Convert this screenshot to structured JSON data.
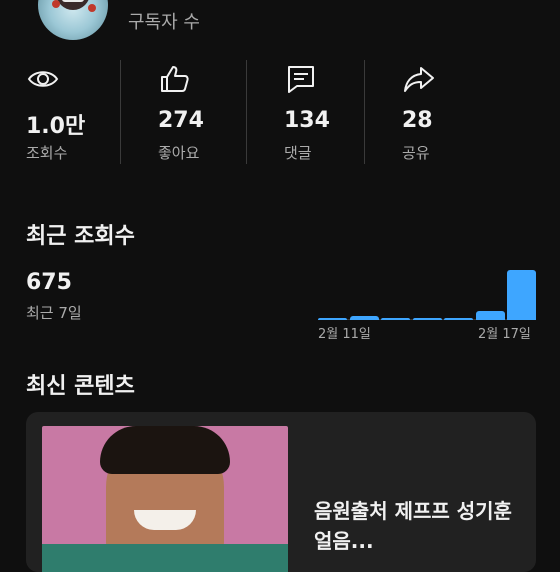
{
  "channel": {
    "subscribers_label": "구독자 수"
  },
  "stats": [
    {
      "icon": "eye-icon",
      "value": "1.0만",
      "label": "조회수"
    },
    {
      "icon": "thumbs-up-icon",
      "value": "274",
      "label": "좋아요"
    },
    {
      "icon": "comment-icon",
      "value": "134",
      "label": "댓글"
    },
    {
      "icon": "share-icon",
      "value": "28",
      "label": "공유"
    }
  ],
  "recent_views": {
    "title": "최근 조회수",
    "count": "675",
    "period": "최근 7일"
  },
  "chart_data": {
    "type": "bar",
    "categories": [
      "2월 11일",
      "2월 12일",
      "2월 13일",
      "2월 14일",
      "2월 15일",
      "2월 16일",
      "2월 17일"
    ],
    "values": [
      4,
      8,
      3,
      3,
      3,
      18,
      100
    ],
    "tick_labels": [
      "2월 11일",
      "2월 17일"
    ],
    "color": "#3ea6ff",
    "title": "",
    "xlabel": "",
    "ylabel": ""
  },
  "latest_content": {
    "title": "최신 콘텐츠",
    "video_title": "음원출처 제프프 성기훈 얼음..."
  },
  "colors": {
    "background": "#0f0f0f",
    "card": "#212121",
    "accent": "#3ea6ff",
    "secondary_text": "#aaaaaa"
  }
}
